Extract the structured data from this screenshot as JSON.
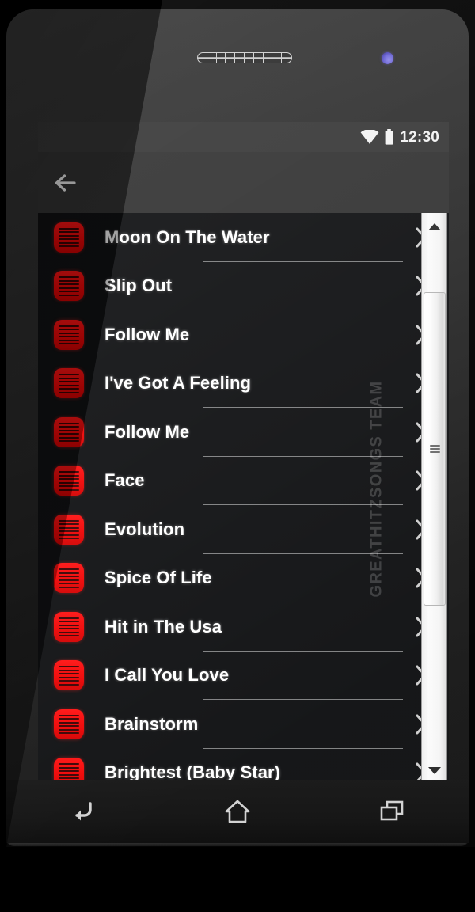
{
  "device": {
    "name": "android-phone",
    "earpiece_icon": "speaker-grille-icon",
    "camera_icon": "front-camera-icon",
    "body_color": "#2c2c2c"
  },
  "status_bar": {
    "wifi_icon": "wifi-icon",
    "battery_icon": "battery-full-icon",
    "time": "12:30"
  },
  "action_bar": {
    "back_icon": "back-arrow-icon",
    "title": ""
  },
  "song_list": {
    "item_icon": "song-list-icon",
    "chevron_icon": "chevron-right-icon",
    "items": [
      {
        "title": "Moon On The Water"
      },
      {
        "title": "Slip Out"
      },
      {
        "title": "Follow Me"
      },
      {
        "title": "I've Got A Feeling"
      },
      {
        "title": "Follow Me"
      },
      {
        "title": "Face"
      },
      {
        "title": "Evolution"
      },
      {
        "title": "Spice Of Life"
      },
      {
        "title": "Hit in The Usa"
      },
      {
        "title": "I Call You Love"
      },
      {
        "title": "Brainstorm"
      },
      {
        "title": "Brightest (Baby Star)"
      }
    ]
  },
  "scrollbar": {
    "up_icon": "scroll-up-arrow-icon",
    "down_icon": "scroll-down-arrow-icon",
    "thumb_grip_icon": "scrollbar-grip-icon"
  },
  "nav_bar": {
    "back_icon": "nav-back-icon",
    "home_icon": "nav-home-icon",
    "recents_icon": "nav-recents-icon"
  },
  "watermark": {
    "text": "GREATHITZSONGS TEAM"
  },
  "colors": {
    "accent_red": "#f00606",
    "screen_bg": "#111214",
    "status_bar_bg": "#3a3a3a",
    "action_bar_bg": "#353535",
    "text_primary": "#ffffff"
  }
}
